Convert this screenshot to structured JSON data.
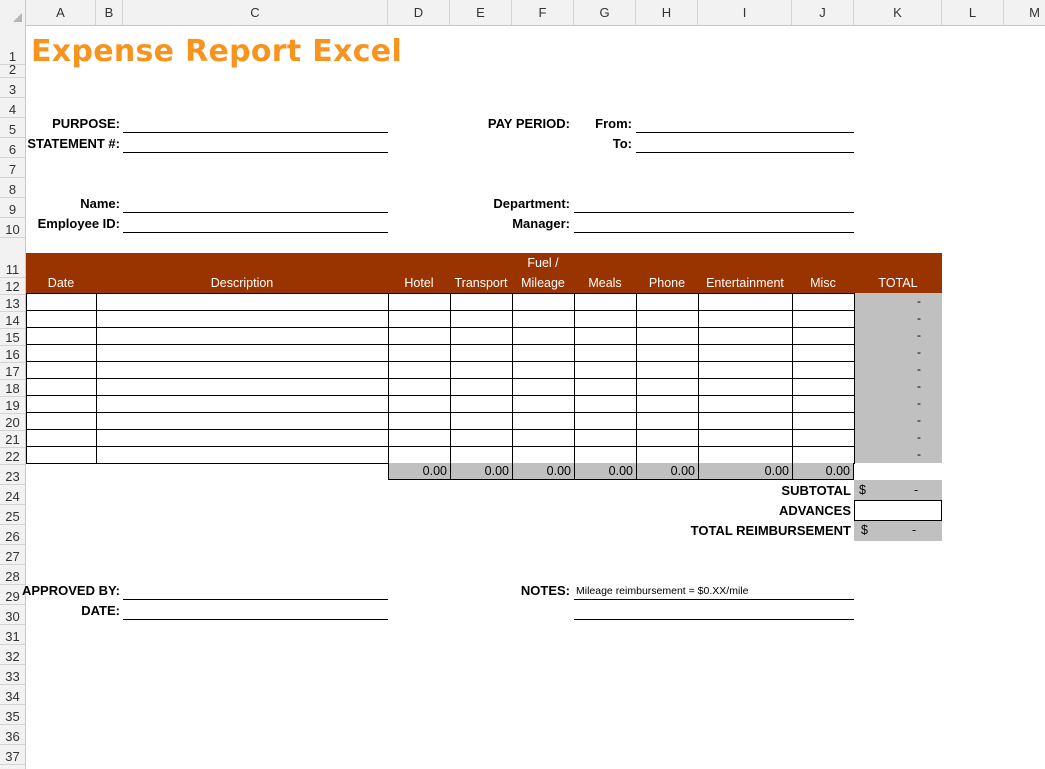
{
  "columns": [
    "A",
    "B",
    "C",
    "D",
    "E",
    "F",
    "G",
    "H",
    "I",
    "J",
    "K",
    "L",
    "M"
  ],
  "rows": [
    "1",
    "2",
    "3",
    "4",
    "5",
    "6",
    "7",
    "8",
    "9",
    "10",
    "11",
    "12",
    "13",
    "14",
    "15",
    "16",
    "17",
    "18",
    "19",
    "20",
    "21",
    "22",
    "23",
    "24",
    "25",
    "26",
    "27",
    "28",
    "29",
    "30",
    "31",
    "32",
    "33",
    "34",
    "35",
    "36",
    "37"
  ],
  "title": "Expense Report Excel",
  "form": {
    "purpose": "PURPOSE:",
    "statement": "STATEMENT #:",
    "pay_period": "PAY PERIOD:",
    "from": "From:",
    "to": "To:",
    "name": "Name:",
    "employee_id": "Employee ID:",
    "department": "Department:",
    "manager": "Manager:"
  },
  "table": {
    "headers": {
      "date": "Date",
      "description": "Description",
      "hotel": "Hotel",
      "transport": "Transport",
      "fuel_line1": "Fuel /",
      "fuel_line2": "Mileage",
      "meals": "Meals",
      "phone": "Phone",
      "entertainment": "Entertainment",
      "misc": "Misc",
      "total": "TOTAL"
    },
    "row_total": "-",
    "column_totals": [
      "0.00",
      "0.00",
      "0.00",
      "0.00",
      "0.00",
      "0.00",
      "0.00"
    ]
  },
  "summary": {
    "subtotal_label": "SUBTOTAL",
    "subtotal_currency": "$",
    "subtotal_value": "-",
    "advances_label": "ADVANCES",
    "reimb_label": "TOTAL REIMBURSEMENT",
    "reimb_currency": "$",
    "reimb_value": "-"
  },
  "approval": {
    "approved_by": "APPROVED BY:",
    "date": "DATE:",
    "notes_label": "NOTES:",
    "notes_text": "Mileage reimbursement = $0.XX/mile"
  },
  "colors": {
    "title": "#F7941D",
    "header_fill": "#993300",
    "total_fill": "#C0C0C0"
  }
}
